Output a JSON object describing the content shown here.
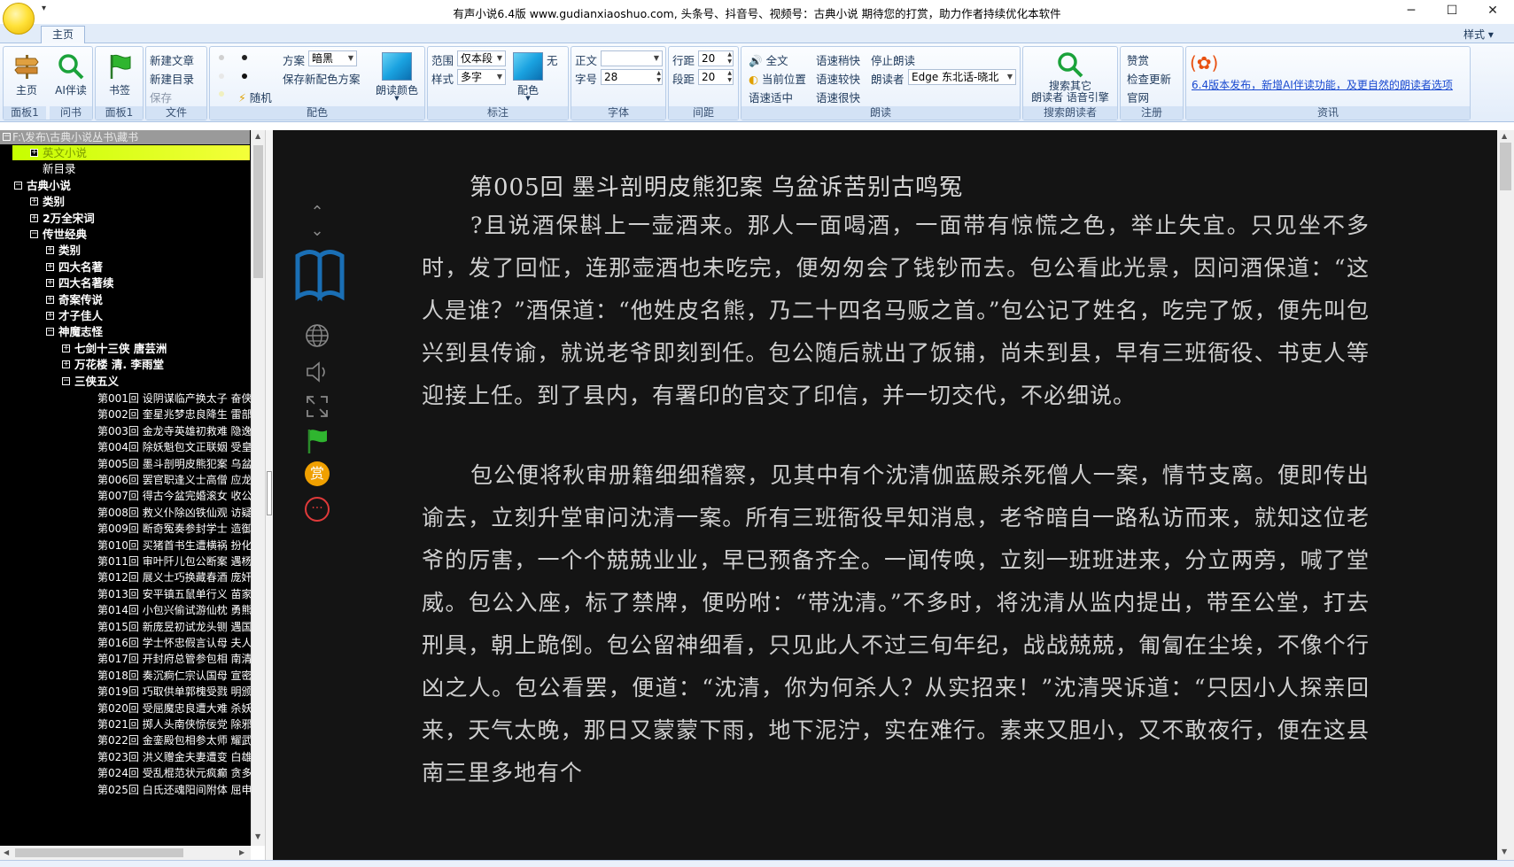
{
  "window": {
    "title": "有声小说6.4版    www.gudianxiaoshuo.com, 头条号、抖音号、视频号：古典小说  期待您的打赏，助力作者持续优化本软件",
    "quick_access": "▾"
  },
  "tabs": {
    "home": "主页",
    "style_menu": "样式 ▾"
  },
  "ribbon": {
    "panel1": {
      "home": "主页",
      "ai": "AI伴读",
      "label": "面板1"
    },
    "ask": {
      "label": "问书"
    },
    "bookmark": {
      "name": "书签",
      "label": "面板1"
    },
    "file": {
      "new_article": "新建文章",
      "new_dir": "新建目录",
      "save": "保存",
      "label": "文件"
    },
    "color": {
      "scheme_label": "方案",
      "scheme_value": "暗黑",
      "save_scheme": "保存新配色方案",
      "random": "随机",
      "read_color": "朗读颜色",
      "label": "配色"
    },
    "mark": {
      "range_label": "范围",
      "range_value": "仅本段",
      "style_label": "样式",
      "style_value": "多字",
      "none": "无",
      "color": "配色",
      "label": "标注"
    },
    "font": {
      "main_label": "正文",
      "size_label": "字号",
      "size_value": "28",
      "label": "字体"
    },
    "spacing": {
      "line_label": "行距",
      "line_value": "20",
      "para_label": "段距",
      "para_value": "20",
      "label": "间距"
    },
    "read": {
      "full": "全文",
      "slow": "语速稍快",
      "stop": "停止朗读",
      "current": "当前位置",
      "faster": "语速较快",
      "reader_label": "朗读者",
      "reader_value": "Edge 东北话-晓北",
      "normal": "语速适中",
      "fastest": "语速很快",
      "label": "朗读"
    },
    "search": {
      "line1": "搜索其它",
      "line2": "朗读者 语音引擎",
      "label": "搜索朗读者"
    },
    "register": {
      "donate": "赞赏",
      "update": "检查更新",
      "site": "官网",
      "label": "注册"
    },
    "news": {
      "text": "6.4版本发布，新增AI伴读功能，及更自然的朗读者选项",
      "label": "资讯"
    }
  },
  "tree": {
    "path": "F:\\发布\\古典小说丛书\\藏书",
    "nodes": [
      {
        "text": "英文小说",
        "box": "+",
        "bold": false
      },
      {
        "text": "新目录",
        "box": "",
        "bold": false
      },
      {
        "text": "古典小说",
        "box": "−",
        "bold": true
      },
      {
        "text": "类别",
        "box": "+",
        "bold": true
      },
      {
        "text": "2万全宋词",
        "box": "+",
        "bold": true
      },
      {
        "text": "传世经典",
        "box": "−",
        "bold": true
      },
      {
        "text": "类别",
        "box": "+",
        "bold": true
      },
      {
        "text": "四大名著",
        "box": "+",
        "bold": true
      },
      {
        "text": "四大名著续",
        "box": "+",
        "bold": true
      },
      {
        "text": "奇案传说",
        "box": "+",
        "bold": true
      },
      {
        "text": "才子佳人",
        "box": "+",
        "bold": true
      },
      {
        "text": "神魔志怪",
        "box": "−",
        "bold": true
      },
      {
        "text": "七剑十三侠  唐芸洲",
        "box": "+",
        "bold": true
      },
      {
        "text": "万花楼  清. 李雨堂",
        "box": "+",
        "bold": true
      },
      {
        "text": "三侠五义",
        "box": "−",
        "bold": true
      }
    ],
    "chapters": [
      "第001回  设阴谋临产换太子  奋侠",
      "第002回  奎星兆梦忠良降生  雷部",
      "第003回  金龙寺英雄初救难  隐逸",
      "第004回  除妖魁包文正联姻  受皇",
      "第005回  墨斗剖明皮熊犯案  乌盆",
      "第006回  罢官职逢义士高僧  应龙",
      "第007回  得古今盆完婚滚女  收公",
      "第008回  救义仆除凶铁仙观  访疑",
      "第009回  断奇冤奏参封学士  造御",
      "第010回  买猪首书生遭横祸  扮化",
      "第011回  审叶阡儿包公断案  遇杨",
      "第012回  展义士巧换藏春酒  庞奸",
      "第013回  安平镇五鼠单行义  苗家",
      "第014回  小包兴偷试游仙枕  勇熊",
      "第015回  新庞昱初试龙头铡  遇国",
      "第016回  学士怀忠假言认母  夫人",
      "第017回  开封府总管参包相  南清",
      "第018回  奏沉痾仁宗认国母  宣密",
      "第019回  巧取供单郭槐受戮  明颁",
      "第020回  受屈魔忠良遭大难  杀妖",
      "第021回  掷人头南侠惊佞党  除邪",
      "第022回  金銮殿包相参太师  耀武",
      "第023回  洪义赠金夫妻遭变  白雄",
      "第024回  受乱棍范状元疯癫  贪多",
      "第025回  白氏还魂阳间附体  屈申"
    ]
  },
  "reader": {
    "chapter_title": "第005回  墨斗剖明皮熊犯案  乌盆诉苦别古鸣冤",
    "paragraphs": [
      "?且说酒保斟上一壶酒来。那人一面喝酒，一面带有惊慌之色，举止失宜。只见坐不多时，发了回怔，连那壶酒也未吃完，便匆匆会了钱钞而去。包公看此光景，因问酒保道：“这人是谁？”酒保道：“他姓皮名熊，乃二十四名马贩之首。”包公记了姓名，吃完了饭，便先叫包兴到县传谕，就说老爷即刻到任。包公随后就出了饭铺，尚未到县，早有三班衙役、书吏人等迎接上任。到了县内，有署印的官交了印信，并一切交代，不必细说。",
      "包公便将秋审册籍细细稽察，见其中有个沈清伽蓝殿杀死僧人一案，情节支离。便即传出谕去，立刻升堂审问沈清一案。所有三班衙役早知消息，老爷暗自一路私访而来，就知这位老爷的厉害，一个个兢兢业业，早已预备齐全。一闻传唤，立刻一班班进来，分立两旁，喊了堂威。包公入座，标了禁牌，便吩咐：“带沈清。”不多时，将沈清从监内提出，带至公堂，打去刑具，朝上跪倒。包公留神细看，只见此人不过三旬年纪，战战兢兢，匍匐在尘埃，不像个行凶之人。包公看罢，便道：“沈清，你为何杀人？从实招来！”沈清哭诉道：“只因小人探亲回来，天气太晚，那日又蒙蒙下雨，地下泥泞，实在难行。素来又胆小，又不敢夜行，便在这县南三里多地有个"
    ],
    "side_reward": "赏"
  },
  "colors": {
    "reader_bg": "#141414",
    "reader_text": "#cfcfcf",
    "tree_highlight": "#d8ff1a",
    "reward": "#f0a000",
    "more": "#e03a3a"
  }
}
